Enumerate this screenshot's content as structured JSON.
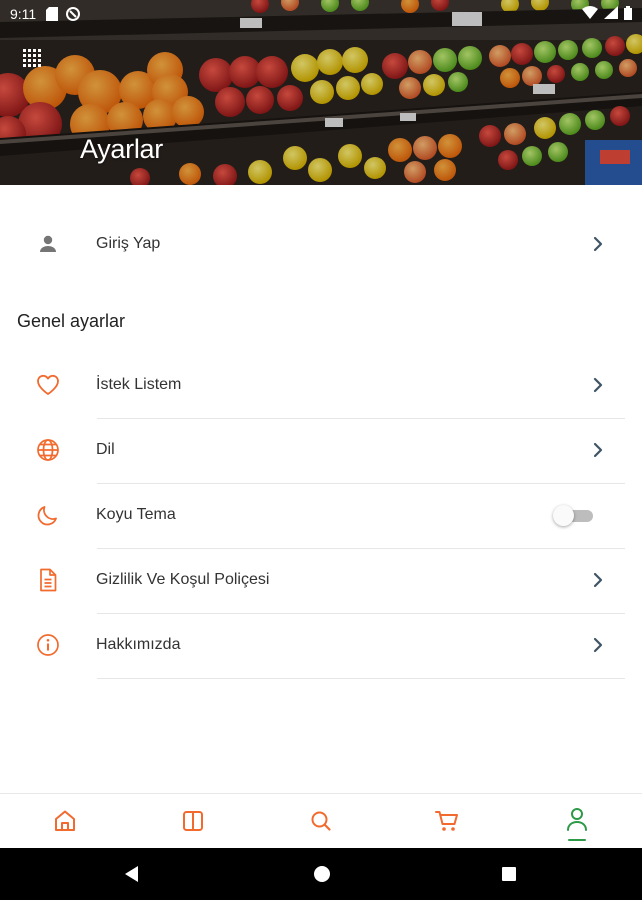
{
  "status_bar": {
    "time": "9:11"
  },
  "header": {
    "title": "Ayarlar"
  },
  "login": {
    "label": "Giriş Yap"
  },
  "general_section": {
    "title": "Genel ayarlar"
  },
  "settings_items": [
    {
      "label": "İstek Listem",
      "icon": "heart-icon"
    },
    {
      "label": "Dil",
      "icon": "globe-icon"
    },
    {
      "label": "Koyu Tema",
      "icon": "moon-icon",
      "toggle": false
    },
    {
      "label": "Gizlilik Ve Koşul Poliçesi",
      "icon": "document-icon"
    },
    {
      "label": "Hakkımızda",
      "icon": "info-icon"
    }
  ],
  "bottom_nav": [
    {
      "name": "home",
      "icon": "home-icon",
      "active": false
    },
    {
      "name": "categories",
      "icon": "book-icon",
      "active": false
    },
    {
      "name": "search",
      "icon": "search-icon",
      "active": false
    },
    {
      "name": "cart",
      "icon": "cart-icon",
      "active": false
    },
    {
      "name": "profile",
      "icon": "user-icon",
      "active": true
    }
  ],
  "colors": {
    "accent": "#f26a2e",
    "active": "#2e9a48",
    "text": "#333333"
  }
}
